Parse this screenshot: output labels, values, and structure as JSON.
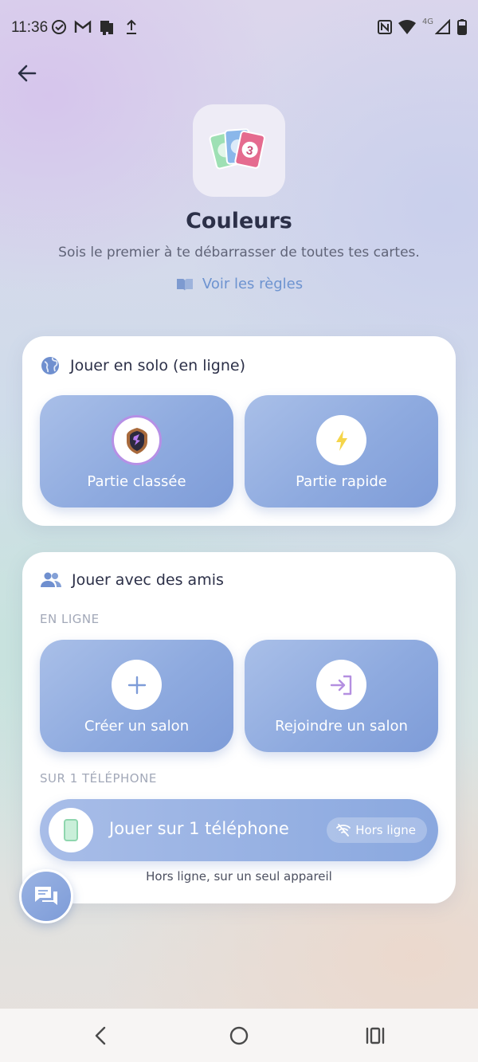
{
  "status_bar": {
    "time": "11:36",
    "left_icons": [
      "check-circle-icon",
      "gmail-icon",
      "app-notification-icon",
      "upload-icon"
    ],
    "right_icons": [
      "nfc-icon",
      "wifi-icon",
      "signal-4g-icon",
      "battery-icon"
    ],
    "network_label": "4G"
  },
  "header": {
    "back_icon": "arrow-left-icon",
    "game_icon": "cards-icon",
    "title": "Couleurs",
    "subtitle": "Sois le premier à te débarrasser de toutes tes cartes.",
    "rules_link": "Voir les règles"
  },
  "solo": {
    "heading": "Jouer en solo (en ligne)",
    "heading_icon": "globe-icon",
    "buttons": [
      {
        "label": "Partie classée",
        "icon": "ranked-shield-icon"
      },
      {
        "label": "Partie rapide",
        "icon": "lightning-icon"
      }
    ]
  },
  "friends": {
    "heading": "Jouer avec des amis",
    "heading_icon": "people-icon",
    "online_label": "EN LIGNE",
    "buttons": [
      {
        "label": "Créer un salon",
        "icon": "plus-icon"
      },
      {
        "label": "Rejoindre un salon",
        "icon": "login-icon"
      }
    ],
    "one_phone_label": "SUR 1 TÉLÉPHONE",
    "one_phone_button": "Jouer sur 1 téléphone",
    "offline_badge": "Hors ligne",
    "one_phone_caption": "Hors ligne, sur un seul appareil"
  },
  "chat_fab_icon": "chat-icon",
  "nav": {
    "icons": [
      "nav-back-icon",
      "nav-home-icon",
      "nav-recents-icon"
    ]
  },
  "colors": {
    "accent": "#6d93d0",
    "button_gradient_start": "#a9bfe8",
    "button_gradient_end": "#7e9cd8",
    "card_background": "#ffffff"
  }
}
